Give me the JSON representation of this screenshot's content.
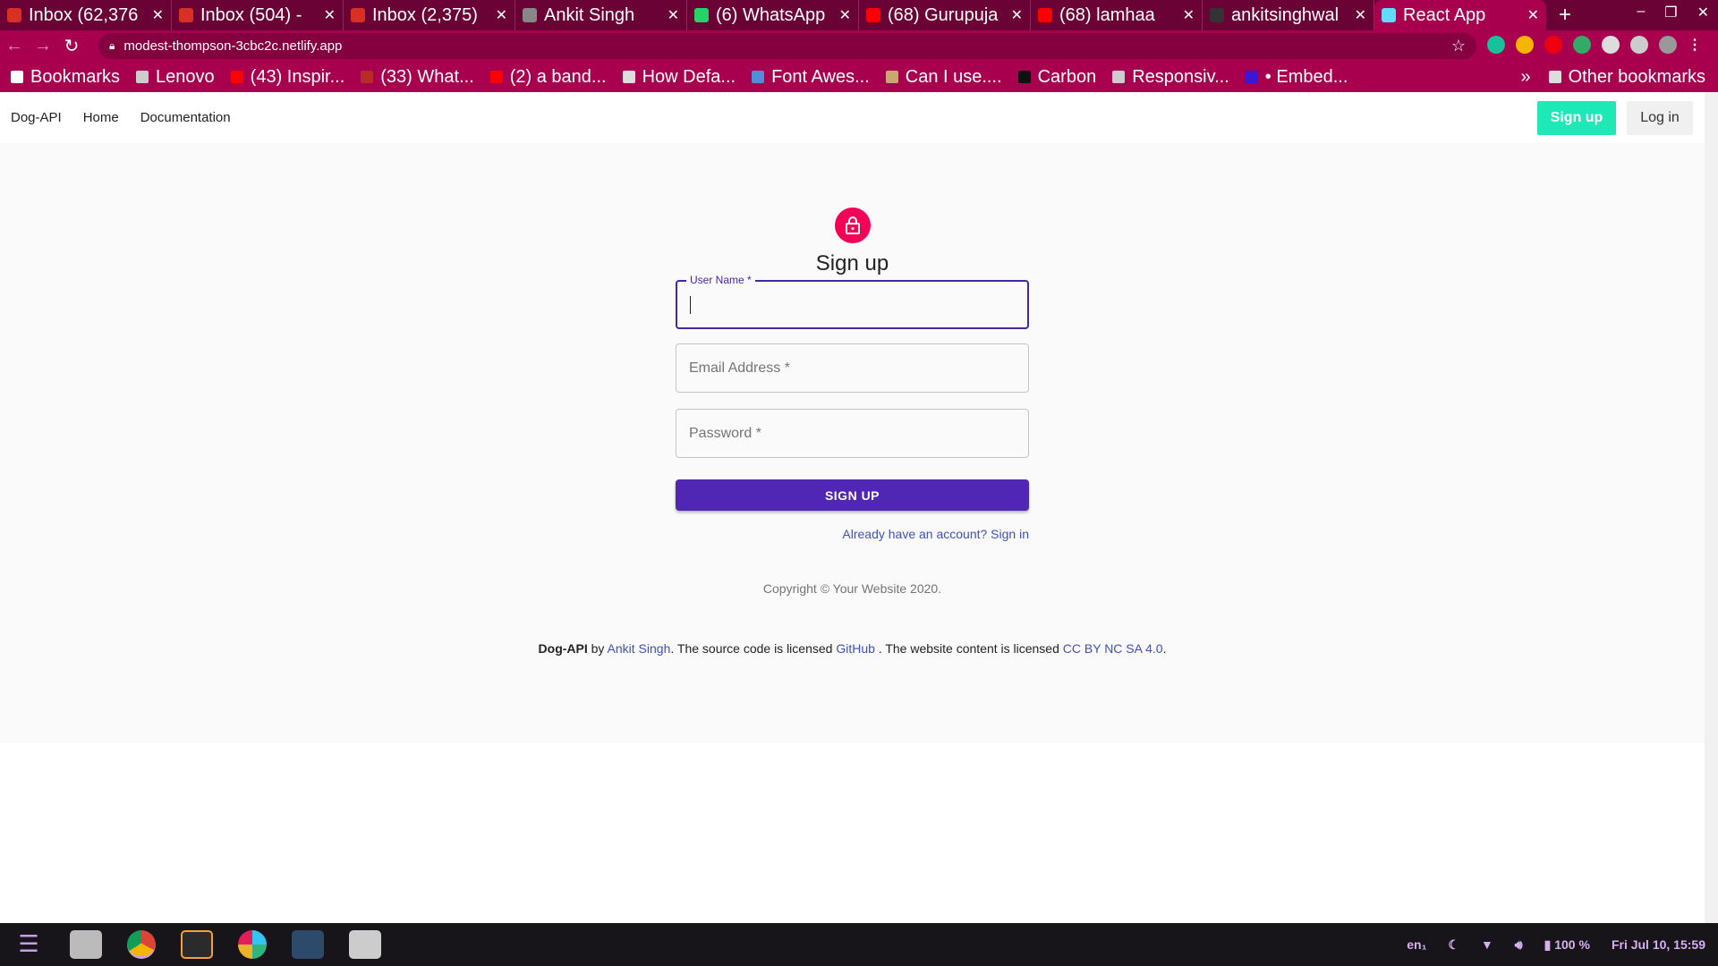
{
  "browser": {
    "tabs": [
      {
        "title": "Inbox (62,376",
        "icon": "gmail-icon",
        "color": "#d93025"
      },
      {
        "title": "Inbox (504) -",
        "icon": "gmail-icon",
        "color": "#d93025"
      },
      {
        "title": "Inbox (2,375)",
        "icon": "gmail-icon",
        "color": "#d93025"
      },
      {
        "title": "Ankit Singh",
        "icon": "victory-hand-icon",
        "color": "#888888"
      },
      {
        "title": "(6) WhatsApp",
        "icon": "whatsapp-icon",
        "color": "#25d366"
      },
      {
        "title": "(68) Gurupuja",
        "icon": "youtube-icon",
        "color": "#ff0000"
      },
      {
        "title": "(68) lamhaa",
        "icon": "youtube-icon",
        "color": "#ff0000"
      },
      {
        "title": "ankitsinghwal",
        "icon": "github-icon",
        "color": "#333333"
      },
      {
        "title": "React App",
        "icon": "react-icon",
        "color": "#61dafb"
      }
    ],
    "url": "modest-thompson-3cbc2c.netlify.app",
    "bookmarks": [
      {
        "label": "Bookmarks",
        "color": "#ffffff"
      },
      {
        "label": "Lenovo",
        "color": "#cccccc"
      },
      {
        "label": "(43) Inspir...",
        "color": "#ff0000"
      },
      {
        "label": "(33) What...",
        "color": "#b92b27"
      },
      {
        "label": "(2) a band...",
        "color": "#ff0000"
      },
      {
        "label": "How Defa...",
        "color": "#dddddd"
      },
      {
        "label": "Font Awes...",
        "color": "#528dd7"
      },
      {
        "label": "Can I use....",
        "color": "#c9a76e"
      },
      {
        "label": "Carbon",
        "color": "#111111"
      },
      {
        "label": "Responsiv...",
        "color": "#cccccc"
      },
      {
        "label": "• Embed...",
        "color": "#3a17d6"
      }
    ],
    "other_bookmarks": "Other bookmarks"
  },
  "app": {
    "brand": "Dog-API",
    "nav": [
      "Home",
      "Documentation"
    ],
    "signup_button": "Sign up",
    "login_button": "Log in",
    "title": "Sign up",
    "fields": {
      "username": "User Name *",
      "email": "Email Address *",
      "password": "Password *"
    },
    "submit": "SIGN UP",
    "signin_link": "Already have an account? Sign in",
    "copyright": "Copyright © Your Website 2020.",
    "footer": {
      "brand": "Dog-API",
      "by": " by ",
      "author": "Ankit Singh",
      "mid": ". The source code is licensed ",
      "github": "GitHub",
      "mid2": " . The website content is licensed ",
      "license": "CC BY NC SA 4.0",
      "end": "."
    },
    "accent": "#5026b5",
    "avatar_color": "#f50057",
    "signup_color": "#1de9b6"
  },
  "taskbar": {
    "lang": "en₁",
    "battery": "100 %",
    "clock": "Fri Jul 10, 15:59"
  }
}
